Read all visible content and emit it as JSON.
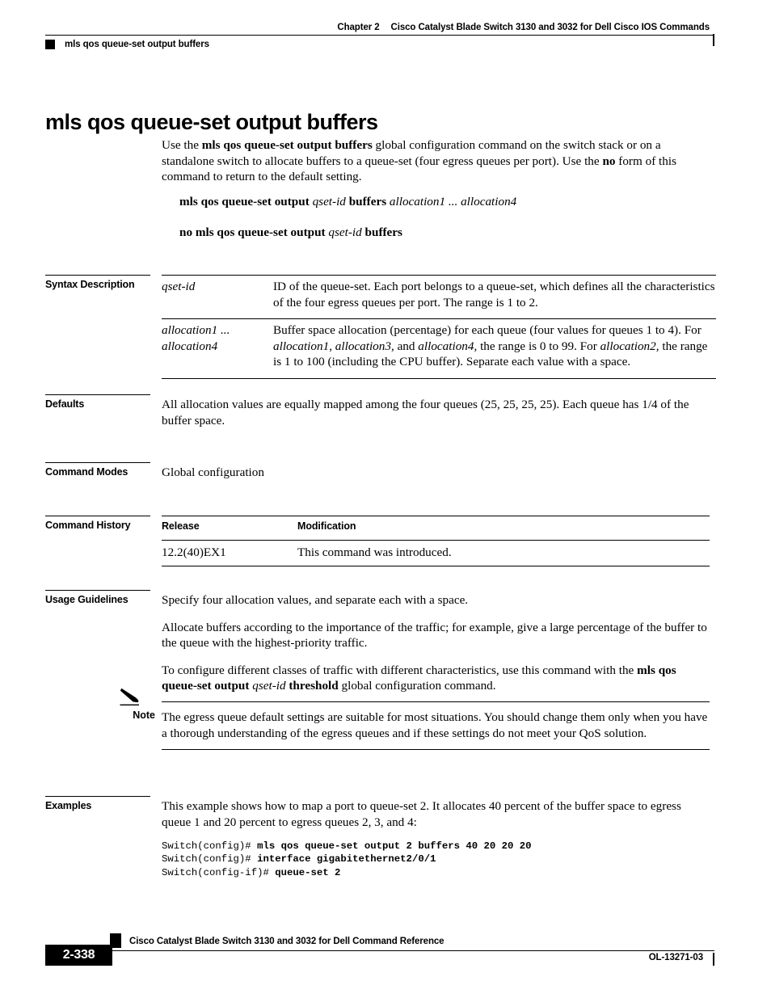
{
  "header": {
    "chapter": "Chapter 2",
    "book_title": "Cisco Catalyst Blade Switch 3130 and 3032 for Dell Cisco IOS Commands",
    "running_command": "mls qos queue-set output buffers"
  },
  "title": "mls qos queue-set output buffers",
  "intro": {
    "p1_a": "Use the ",
    "p1_b": "mls qos queue-set output buffers",
    "p1_c": " global configuration command on the switch stack or on a standalone switch to allocate buffers to a queue-set (four egress queues per port). Use the ",
    "p1_d": "no",
    "p1_e": " form of this command to return to the default setting."
  },
  "syntax_lines": {
    "line1_a": "mls qos queue-set output ",
    "line1_b": "qset-id",
    "line1_c": " buffers ",
    "line1_d": "allocation1 ... allocation4",
    "line2_a": "no mls qos queue-set output ",
    "line2_b": "qset-id",
    "line2_c": " buffers"
  },
  "sections": {
    "syntax_description": {
      "label": "Syntax Description",
      "rows": [
        {
          "term": "qset-id",
          "desc": "ID of the queue-set. Each port belongs to a queue-set, which defines all the characteristics of the four egress queues per port. The range is 1 to 2."
        },
        {
          "term_line1": "allocation1 ...",
          "term_line2": "allocation4",
          "desc_a": "Buffer space allocation (percentage) for each queue (four values for queues 1 to 4). For ",
          "desc_i1": "allocation1",
          "desc_b": ", ",
          "desc_i2": "allocation3",
          "desc_c": ", and ",
          "desc_i3": "allocation4",
          "desc_d": ", the range is 0 to 99. For ",
          "desc_i4": "allocation2",
          "desc_e": ", the range is 1 to 100 (including the CPU buffer). Separate each value with a space."
        }
      ]
    },
    "defaults": {
      "label": "Defaults",
      "text": "All allocation values are equally mapped among the four queues (25, 25, 25, 25). Each queue has 1/4 of the buffer space."
    },
    "command_modes": {
      "label": "Command Modes",
      "text": "Global configuration"
    },
    "command_history": {
      "label": "Command History",
      "headers": [
        "Release",
        "Modification"
      ],
      "rows": [
        {
          "release": "12.2(40)EX1",
          "modification": "This command was introduced."
        }
      ]
    },
    "usage_guidelines": {
      "label": "Usage Guidelines",
      "p1": "Specify four allocation values, and separate each with a space.",
      "p2": "Allocate buffers according to the importance of the traffic; for example, give a large percentage of the buffer to the queue with the highest-priority traffic.",
      "p3_a": "To configure different classes of traffic with different characteristics, use this command with the ",
      "p3_b": "mls qos queue-set output ",
      "p3_c": "qset-id",
      "p3_d": " threshold",
      "p3_e": " global configuration command."
    },
    "note": {
      "label": "Note",
      "icon": "pencil-icon",
      "text": "The egress queue default settings are suitable for most situations. You should change them only when you have a thorough understanding of the egress queues and if these settings do not meet your QoS solution."
    },
    "examples": {
      "label": "Examples",
      "intro": "This example shows how to map a port to queue-set 2. It allocates 40 percent of the buffer space to egress queue 1 and 20 percent to egress queues 2, 3, and 4:",
      "code_lines": [
        {
          "prompt": "Switch(config)# ",
          "command": "mls qos queue-set output 2 buffers 40 20 20 20"
        },
        {
          "prompt": "Switch(config)# ",
          "command": "interface gigabitethernet2/0/1"
        },
        {
          "prompt": "Switch(config-if)# ",
          "command": "queue-set 2"
        }
      ]
    }
  },
  "footer": {
    "doc_title": "Cisco Catalyst Blade Switch 3130 and 3032 for Dell Command Reference",
    "page_number": "2-338",
    "doc_id": "OL-13271-03"
  }
}
